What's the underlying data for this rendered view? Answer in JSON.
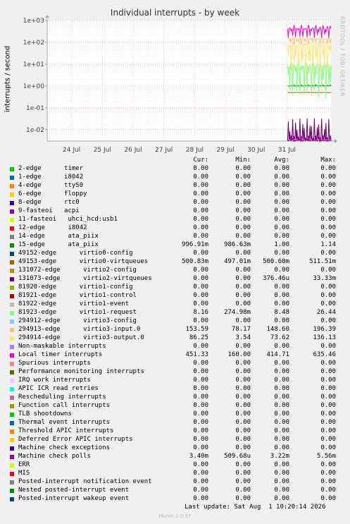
{
  "chart_data": {
    "type": "line",
    "title": "Individual interrupts - by week",
    "ylabel": "interrupts / second",
    "yscale": "log",
    "ylim": [
      0.003,
      1000
    ],
    "yticks": [
      "1e+03",
      "1e+02",
      "1e+01",
      "1e+00",
      "1e-01",
      "1e-02"
    ],
    "xticks": [
      "24 Jul",
      "25 Jul",
      "26 Jul",
      "27 Jul",
      "28 Jul",
      "29 Jul",
      "30 Jul",
      "31 Jul"
    ],
    "xlim": [
      "2026-07-23 05:00",
      "2026-08-01 10:20"
    ],
    "data_start": "2026-07-31 00:30",
    "grid": true,
    "columns": [
      "Cur:",
      "Min:",
      "Avg:",
      "Max:"
    ],
    "series": [
      {
        "name": "2-edge      timer",
        "color": "#00cc00",
        "cur": "0.00",
        "min": "0.00",
        "avg": "0.00",
        "max": "0.00"
      },
      {
        "name": "1-edge      i8042",
        "color": "#0066b3",
        "cur": "0.00",
        "min": "0.00",
        "avg": "0.00",
        "max": "0.00"
      },
      {
        "name": "4-edge      ttyS0",
        "color": "#ff8000",
        "cur": "0.00",
        "min": "0.00",
        "avg": "0.00",
        "max": "0.00"
      },
      {
        "name": "6-edge      floppy",
        "color": "#ffcc00",
        "cur": "0.00",
        "min": "0.00",
        "avg": "0.00",
        "max": "0.00"
      },
      {
        "name": "8-edge      rtc0",
        "color": "#330099",
        "cur": "0.00",
        "min": "0.00",
        "avg": "0.00",
        "max": "0.00"
      },
      {
        "name": "9-fasteoi   acpi",
        "color": "#990099",
        "cur": "0.00",
        "min": "0.00",
        "avg": "0.00",
        "max": "0.00"
      },
      {
        "name": "11-fasteoi   uhci_hcd:usb1",
        "color": "#ccff00",
        "cur": "0.00",
        "min": "0.00",
        "avg": "0.00",
        "max": "0.00"
      },
      {
        "name": "12-edge      i8042",
        "color": "#ff0000",
        "cur": "0.00",
        "min": "0.00",
        "avg": "0.00",
        "max": "0.00"
      },
      {
        "name": "14-edge      ata_piix",
        "color": "#808080",
        "cur": "0.00",
        "min": "0.00",
        "avg": "0.00",
        "max": "0.00"
      },
      {
        "name": "15-edge      ata_piix",
        "color": "#008f00",
        "cur": "996.91m",
        "min": "986.63m",
        "avg": "1.00",
        "max": "1.14"
      },
      {
        "name": "49152-edge      virtio0-config",
        "color": "#00487d",
        "cur": "0.00",
        "min": "0.00",
        "avg": "0.00",
        "max": "0.00"
      },
      {
        "name": "49153-edge      virtio0-virtqueues",
        "color": "#b35a00",
        "cur": "500.83m",
        "min": "497.01m",
        "avg": "500.60m",
        "max": "511.51m"
      },
      {
        "name": "131072-edge      virtio2-config",
        "color": "#b38f00",
        "cur": "0.00",
        "min": "0.00",
        "avg": "0.00",
        "max": "0.00"
      },
      {
        "name": "131073-edge      virtio2-virtqueues",
        "color": "#6b006b",
        "cur": "0.00",
        "min": "0.00",
        "avg": "376.46u",
        "max": "33.33m"
      },
      {
        "name": "81920-edge      virtio1-config",
        "color": "#8fb300",
        "cur": "0.00",
        "min": "0.00",
        "avg": "0.00",
        "max": "0.00"
      },
      {
        "name": "81921-edge      virtio1-control",
        "color": "#b30000",
        "cur": "0.00",
        "min": "0.00",
        "avg": "0.00",
        "max": "0.00"
      },
      {
        "name": "81922-edge      virtio1-event",
        "color": "#bebebe",
        "cur": "0.00",
        "min": "0.00",
        "avg": "0.00",
        "max": "0.00"
      },
      {
        "name": "81923-edge      virtio1-request",
        "color": "#80ff80",
        "cur": "8.16",
        "min": "274.98m",
        "avg": "8.48",
        "max": "26.44"
      },
      {
        "name": "294912-edge      virtio3-config",
        "color": "#80c9ff",
        "cur": "0.00",
        "min": "0.00",
        "avg": "0.00",
        "max": "0.00"
      },
      {
        "name": "294913-edge      virtio3-input.0",
        "color": "#ffc080",
        "cur": "153.59",
        "min": "78.17",
        "avg": "148.60",
        "max": "196.39"
      },
      {
        "name": "294914-edge      virtio3-output.0",
        "color": "#ffe680",
        "cur": "86.25",
        "min": "3.54",
        "avg": "73.62",
        "max": "136.13"
      },
      {
        "name": "Non-maskable interrupts",
        "color": "#aa80ff",
        "cur": "0.00",
        "min": "0.00",
        "avg": "0.00",
        "max": "0.00"
      },
      {
        "name": "Local timer interrupts",
        "color": "#ee00cc",
        "cur": "451.33",
        "min": "160.00",
        "avg": "414.71",
        "max": "635.46"
      },
      {
        "name": "Spurious interrupts",
        "color": "#ff8080",
        "cur": "0.00",
        "min": "0.00",
        "avg": "0.00",
        "max": "0.00"
      },
      {
        "name": "Performance monitoring interrupts",
        "color": "#666600",
        "cur": "0.00",
        "min": "0.00",
        "avg": "0.00",
        "max": "0.00"
      },
      {
        "name": "IRQ work interrupts",
        "color": "#ffbfff",
        "cur": "0.00",
        "min": "0.00",
        "avg": "0.00",
        "max": "0.00"
      },
      {
        "name": "APIC ICR read retries",
        "color": "#00ffcc",
        "cur": "0.00",
        "min": "0.00",
        "avg": "0.00",
        "max": "0.00"
      },
      {
        "name": "Rescheduling interrupts",
        "color": "#cc6699",
        "cur": "0.00",
        "min": "0.00",
        "avg": "0.00",
        "max": "0.00"
      },
      {
        "name": "Function call interrupts",
        "color": "#999900",
        "cur": "0.00",
        "min": "0.00",
        "avg": "0.00",
        "max": "0.00"
      },
      {
        "name": "TLB shootdowns",
        "color": "#00cc00",
        "cur": "0.00",
        "min": "0.00",
        "avg": "0.00",
        "max": "0.00"
      },
      {
        "name": "Thermal event interrupts",
        "color": "#0066b3",
        "cur": "0.00",
        "min": "0.00",
        "avg": "0.00",
        "max": "0.00"
      },
      {
        "name": "Threshold APIC interrupts",
        "color": "#ff8000",
        "cur": "0.00",
        "min": "0.00",
        "avg": "0.00",
        "max": "0.00"
      },
      {
        "name": "Deferred Error APIC interrupts",
        "color": "#ffcc00",
        "cur": "0.00",
        "min": "0.00",
        "avg": "0.00",
        "max": "0.00"
      },
      {
        "name": "Machine check exceptions",
        "color": "#330099",
        "cur": "0.00",
        "min": "0.00",
        "avg": "0.00",
        "max": "0.00"
      },
      {
        "name": "Machine check polls",
        "color": "#990099",
        "cur": "3.40m",
        "min": "509.68u",
        "avg": "3.22m",
        "max": "5.56m"
      },
      {
        "name": "ERR",
        "color": "#ccff00",
        "cur": "0.00",
        "min": "0.00",
        "avg": "0.00",
        "max": "0.00"
      },
      {
        "name": "MIS",
        "color": "#ff0000",
        "cur": "0.00",
        "min": "0.00",
        "avg": "0.00",
        "max": "0.00"
      },
      {
        "name": "Posted-interrupt notification event",
        "color": "#808080",
        "cur": "0.00",
        "min": "0.00",
        "avg": "0.00",
        "max": "0.00"
      },
      {
        "name": "Nested posted-interrupt event",
        "color": "#008f00",
        "cur": "0.00",
        "min": "0.00",
        "avg": "0.00",
        "max": "0.00"
      },
      {
        "name": "Posted-interrupt wakeup event",
        "color": "#00487d",
        "cur": "0.00",
        "min": "0.00",
        "avg": "0.00",
        "max": "0.00"
      }
    ]
  },
  "watermark": "RRDTOOL / TOBI OETIKER",
  "last_update": "Last update: Sat Aug  1 10:20:14 2026",
  "version": "Munin 2.0.57"
}
